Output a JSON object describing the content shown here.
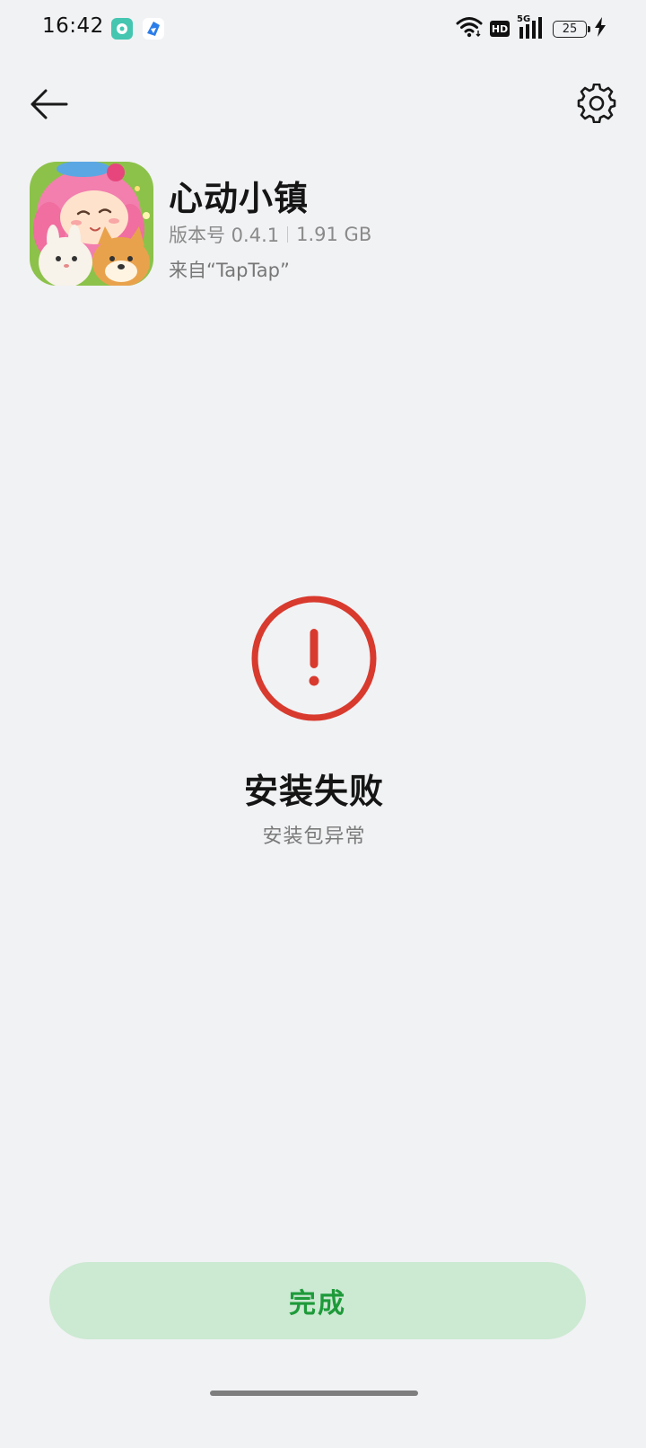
{
  "status_bar": {
    "time": "16:42",
    "net_badge": "HD",
    "signal_label": "5G",
    "battery_level": "25"
  },
  "app": {
    "name": "心动小镇",
    "version": "版本号 0.4.1",
    "size": "1.91 GB",
    "source": "来自“TapTap”"
  },
  "result": {
    "title": "安装失败",
    "subtitle": "安装包异常",
    "color": "#d83a2e"
  },
  "actions": {
    "done_label": "完成",
    "done_bg": "#cce9d2",
    "done_text_color": "#1e9a3a"
  }
}
